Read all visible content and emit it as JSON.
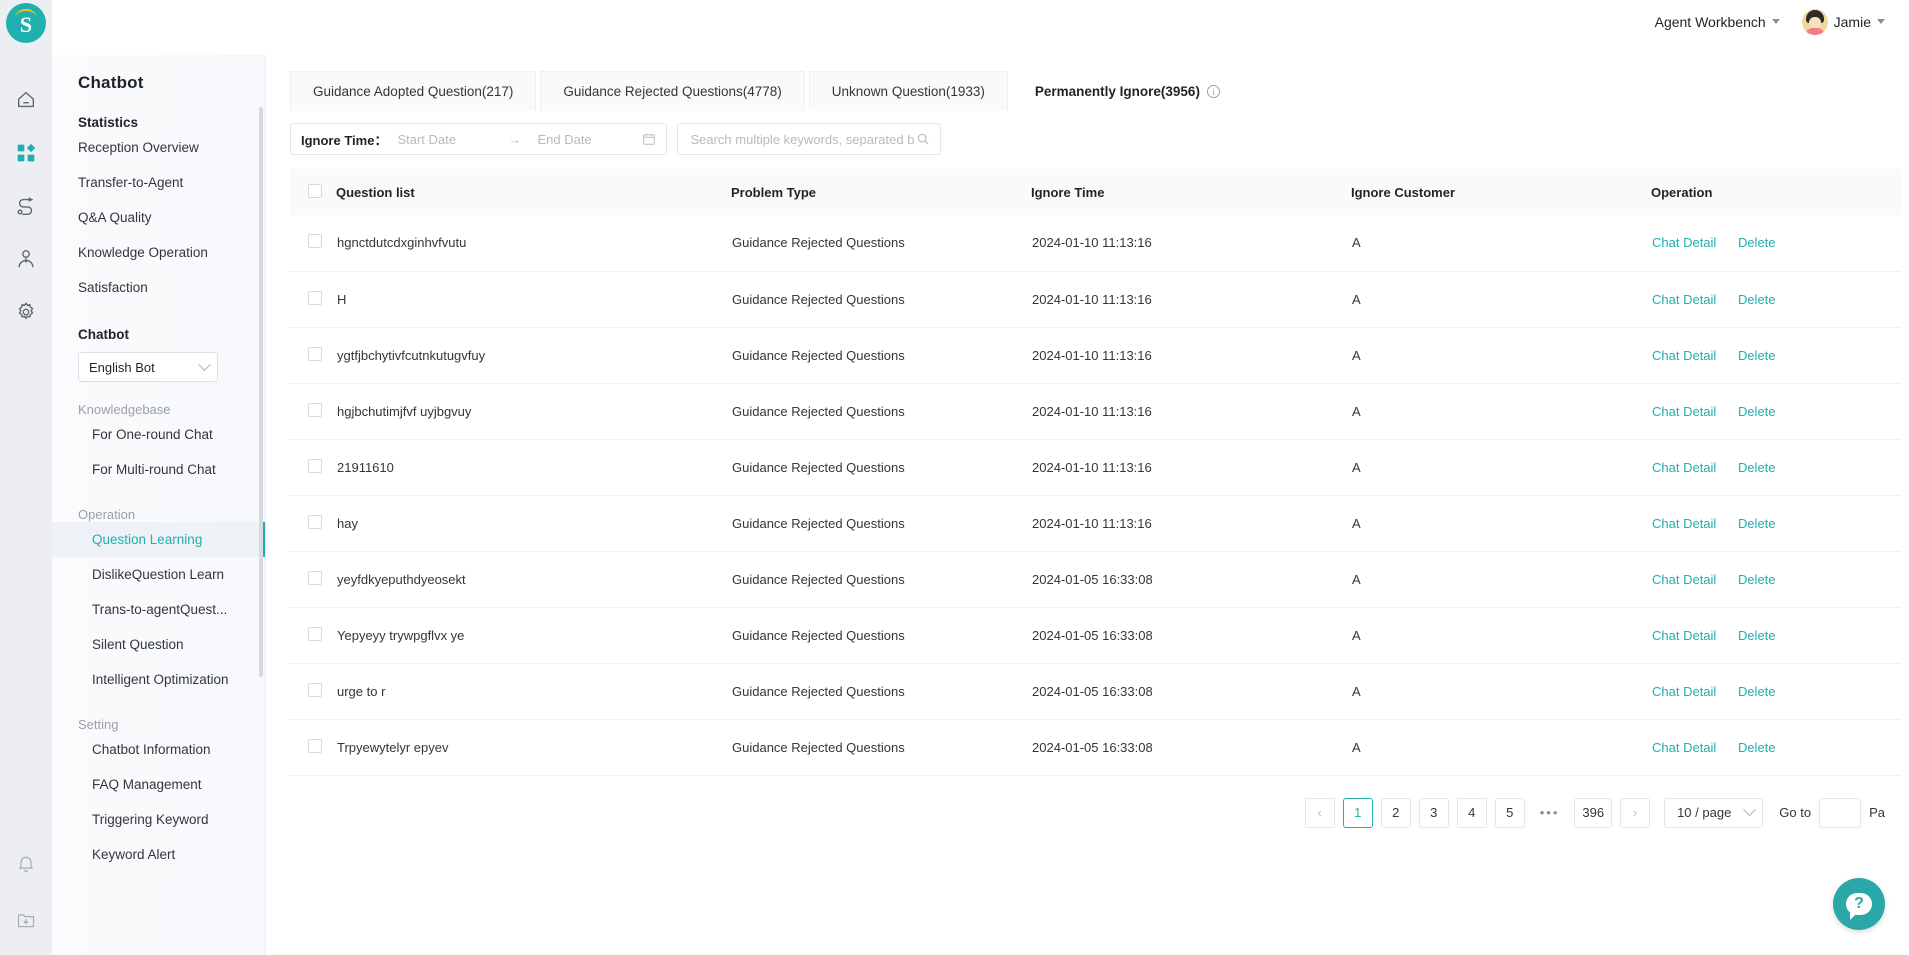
{
  "brand": {
    "logo_letter": "S",
    "accent": "#1fb0af",
    "rail_bg": "#eceef1"
  },
  "topbar": {
    "workbench_label": "Agent Workbench",
    "user_name": "Jamie"
  },
  "sidebar": {
    "title": "Chatbot",
    "groups": [
      {
        "label": "Statistics",
        "muted": false,
        "items": [
          {
            "label": "Reception Overview",
            "active": false,
            "indent": false
          },
          {
            "label": "Transfer-to-Agent",
            "active": false,
            "indent": false
          },
          {
            "label": "Q&A Quality",
            "active": false,
            "indent": false
          },
          {
            "label": "Knowledge Operation",
            "active": false,
            "indent": false
          },
          {
            "label": "Satisfaction",
            "active": false,
            "indent": false
          }
        ]
      }
    ],
    "bot_group_label": "Chatbot",
    "bot_select_value": "English Bot",
    "knowledgebase_label": "Knowledgebase",
    "knowledgebase_items": [
      {
        "label": "For One-round Chat",
        "active": false
      },
      {
        "label": "For Multi-round Chat",
        "active": false
      }
    ],
    "operation_label": "Operation",
    "operation_items": [
      {
        "label": "Question Learning",
        "active": true
      },
      {
        "label": "DislikeQuestion Learn",
        "active": false
      },
      {
        "label": "Trans-to-agentQuest...",
        "active": false
      },
      {
        "label": "Silent Question",
        "active": false
      },
      {
        "label": "Intelligent Optimization",
        "active": false
      }
    ],
    "setting_label": "Setting",
    "setting_items": [
      {
        "label": "Chatbot Information",
        "active": false
      },
      {
        "label": "FAQ Management",
        "active": false
      },
      {
        "label": "Triggering Keyword",
        "active": false
      },
      {
        "label": "Keyword Alert",
        "active": false
      }
    ]
  },
  "tabs": [
    {
      "label": "Guidance Adopted Question(217)",
      "active": false,
      "info": false
    },
    {
      "label": "Guidance Rejected Questions(4778)",
      "active": false,
      "info": false
    },
    {
      "label": "Unknown Question(1933)",
      "active": false,
      "info": false
    },
    {
      "label": "Permanently Ignore(3956)",
      "active": true,
      "info": true
    }
  ],
  "filter": {
    "date_label": "Ignore Time：",
    "start_placeholder": "Start Date",
    "range_arrow": "→",
    "end_placeholder": "End Date",
    "search_placeholder": "Search multiple keywords, separated by ;",
    "search_value": ""
  },
  "table": {
    "columns": [
      "Question list",
      "Problem Type",
      "Ignore Time",
      "Ignore Customer",
      "Operation"
    ],
    "op_labels": {
      "detail": "Chat Detail",
      "delete": "Delete"
    },
    "rows": [
      {
        "question": "hgnctdutcdxginhvfvutu",
        "type": "Guidance Rejected Questions",
        "time": "2024-01-10 11:13:16",
        "customer": "A"
      },
      {
        "question": "H",
        "type": "Guidance Rejected Questions",
        "time": "2024-01-10 11:13:16",
        "customer": "A"
      },
      {
        "question": "ygtfjbchytivfcutnkutugvfuy",
        "type": "Guidance Rejected Questions",
        "time": "2024-01-10 11:13:16",
        "customer": "A"
      },
      {
        "question": "hgjbchutimjfvf uyjbgvuy",
        "type": "Guidance Rejected Questions",
        "time": "2024-01-10 11:13:16",
        "customer": "A"
      },
      {
        "question": "21911610",
        "type": "Guidance Rejected Questions",
        "time": "2024-01-10 11:13:16",
        "customer": "A"
      },
      {
        "question": "hay",
        "type": "Guidance Rejected Questions",
        "time": "2024-01-10 11:13:16",
        "customer": "A"
      },
      {
        "question": "yeyfdkyeputhdyeosekt",
        "type": "Guidance Rejected Questions",
        "time": "2024-01-05 16:33:08",
        "customer": "A"
      },
      {
        "question": "Yepyeyy trywpgflvx ye",
        "type": "Guidance Rejected Questions",
        "time": "2024-01-05 16:33:08",
        "customer": "A"
      },
      {
        "question": "urge to r",
        "type": "Guidance Rejected Questions",
        "time": "2024-01-05 16:33:08",
        "customer": "A"
      },
      {
        "question": "Trpyewytelyr epyev",
        "type": "Guidance Rejected Questions",
        "time": "2024-01-05 16:33:08",
        "customer": "A"
      }
    ]
  },
  "pagination": {
    "prev": "‹",
    "next": "›",
    "pages": [
      "1",
      "2",
      "3",
      "4",
      "5"
    ],
    "dots": "•••",
    "last": "396",
    "current": "1",
    "page_size": "10 / page",
    "goto_label": "Go to",
    "goto_value": "",
    "goto_suffix": "Pa"
  },
  "help": {
    "glyph": "?"
  }
}
